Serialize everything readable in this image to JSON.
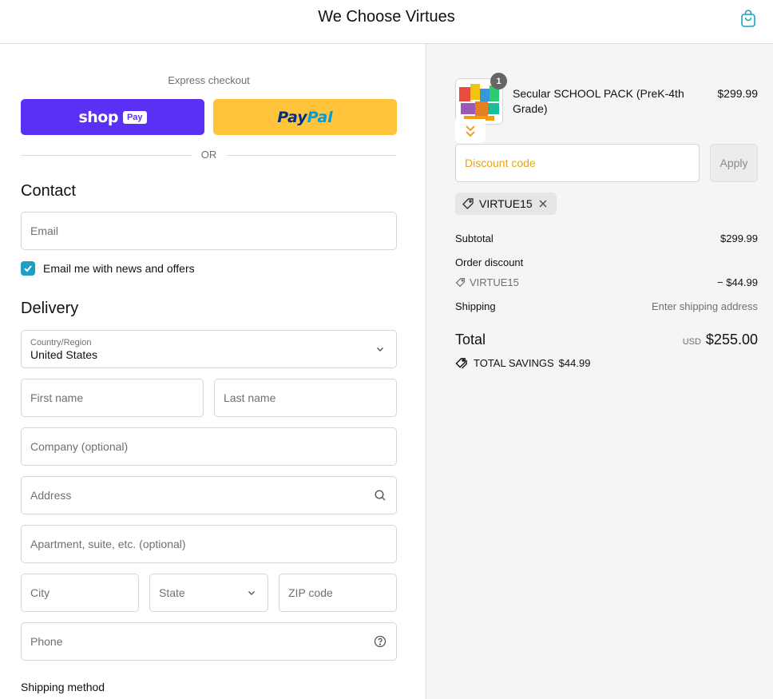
{
  "header": {
    "brand": "We Choose Virtues",
    "cart_icon": "shopping-bag-icon"
  },
  "express": {
    "title": "Express checkout",
    "shop_pay": {
      "word": "shop",
      "pill": "Pay"
    },
    "paypal": {
      "part1": "Pay",
      "part2": "Pal"
    },
    "divider": "OR"
  },
  "contact": {
    "title": "Contact",
    "email_placeholder": "Email",
    "newsletter_label": "Email me with news and offers",
    "newsletter_checked": true
  },
  "delivery": {
    "title": "Delivery",
    "country_label": "Country/Region",
    "country_value": "United States",
    "first_name": "First name",
    "last_name": "Last name",
    "company": "Company (optional)",
    "address": "Address",
    "apartment": "Apartment, suite, etc. (optional)",
    "city": "City",
    "state": "State",
    "zip": "ZIP code",
    "phone": "Phone"
  },
  "shipping_method_title": "Shipping method",
  "summary": {
    "product": {
      "name": "Secular SCHOOL PACK (PreK-4th Grade)",
      "price": "$299.99",
      "quantity": "1"
    },
    "discount_placeholder": "Discount code",
    "apply_label": "Apply",
    "applied_code": "VIRTUE15",
    "subtotal_label": "Subtotal",
    "subtotal_value": "$299.99",
    "order_discount_label": "Order discount",
    "discount_code": "VIRTUE15",
    "discount_value": "− $44.99",
    "shipping_label": "Shipping",
    "shipping_value": "Enter shipping address",
    "total_label": "Total",
    "currency": "USD",
    "total_value": "$255.00",
    "savings_label": "TOTAL SAVINGS",
    "savings_value": "$44.99"
  },
  "colors": {
    "accent": "#1f9fc3",
    "shop_pay": "#5a31f4",
    "paypal": "#ffc439",
    "discount_text": "#e8a317"
  }
}
